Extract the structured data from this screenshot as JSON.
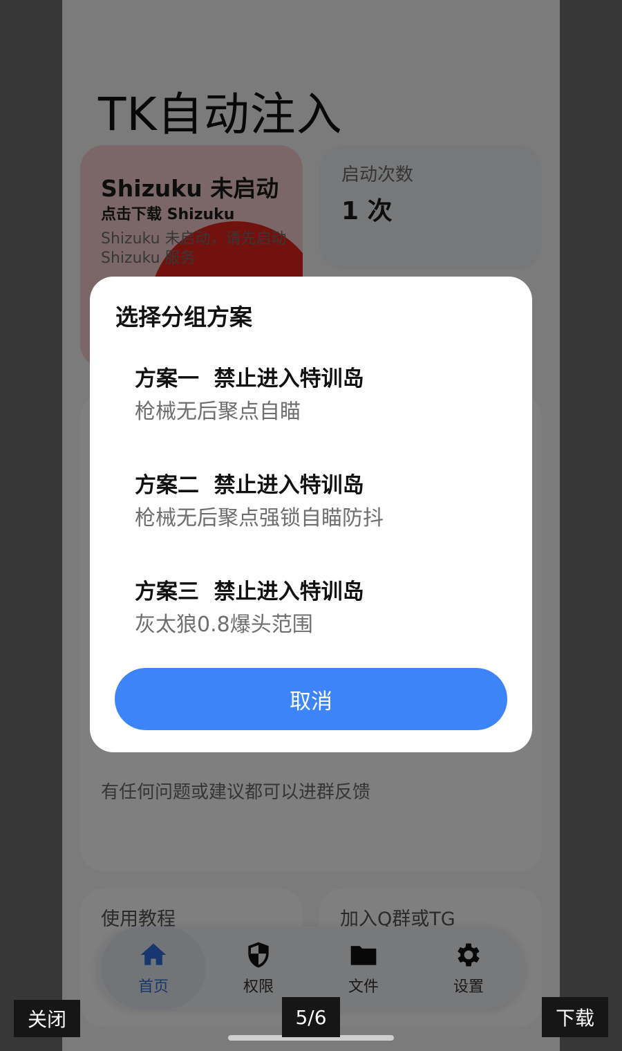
{
  "app": {
    "title": "TK自动注入"
  },
  "cards": {
    "shizuku": {
      "title": "Shizuku 未启动",
      "action": "点击下载 Shizuku",
      "desc": "Shizuku 未启动，请先启动 Shizuku 服务"
    },
    "launch": {
      "label": "启动次数",
      "value": "1 次"
    },
    "feedback": "有任何问题或建议都可以进群反馈",
    "tutorial": {
      "label": "使用教程"
    },
    "group": {
      "label": "加入Q群或TG"
    }
  },
  "dialog": {
    "title": "选择分组方案",
    "options": [
      {
        "title": "方案一  禁止进入特训岛",
        "desc": "枪械无后聚点自瞄"
      },
      {
        "title": "方案二  禁止进入特训岛",
        "desc": "枪械无后聚点强锁自瞄防抖"
      },
      {
        "title": "方案三  禁止进入特训岛",
        "desc": "灰太狼0.8爆头范围"
      }
    ],
    "cancel_label": "取消"
  },
  "nav": {
    "items": [
      {
        "label": "首页",
        "icon": "home-icon",
        "active": true
      },
      {
        "label": "权限",
        "icon": "shield-icon",
        "active": false
      },
      {
        "label": "文件",
        "icon": "folder-icon",
        "active": false
      },
      {
        "label": "设置",
        "icon": "gear-icon",
        "active": false
      }
    ],
    "active_color": "#2f6fdc"
  },
  "viewer": {
    "close_label": "关闭",
    "pager": "5/6",
    "download_label": "下载"
  },
  "colors": {
    "accent": "#3c84f7",
    "shizuku_card": "#f7cfcf",
    "shizuku_blob": "#e5251f"
  }
}
